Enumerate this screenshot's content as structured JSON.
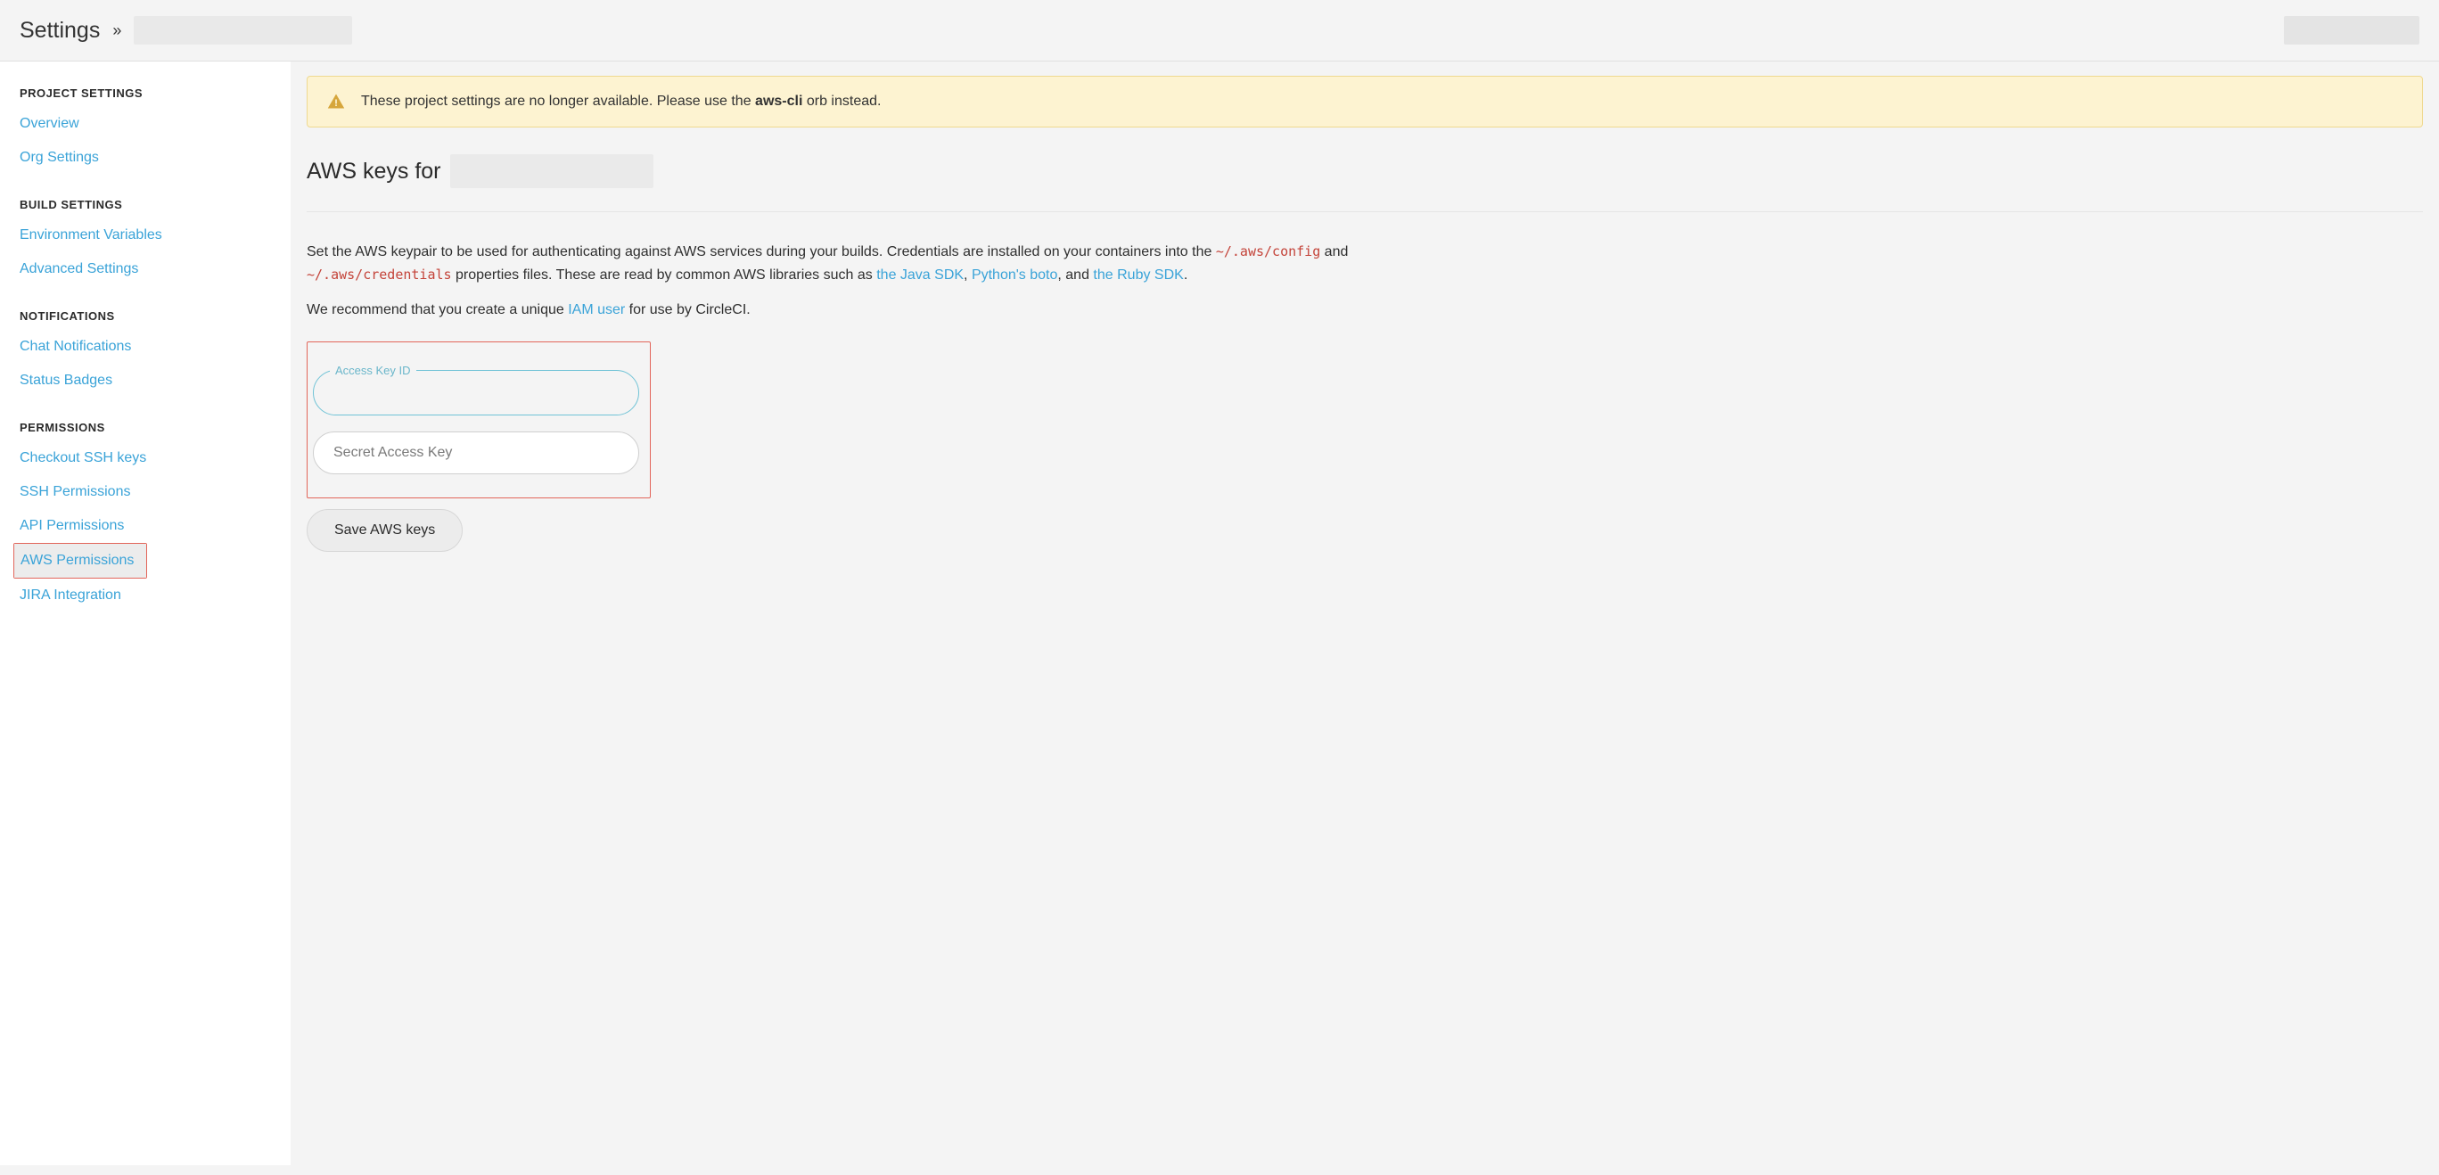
{
  "header": {
    "title": "Settings",
    "separator": "»"
  },
  "sidebar": {
    "sections": {
      "project_settings": {
        "title": "PROJECT SETTINGS",
        "items": [
          {
            "label": "Overview"
          },
          {
            "label": "Org Settings"
          }
        ]
      },
      "build_settings": {
        "title": "BUILD SETTINGS",
        "items": [
          {
            "label": "Environment Variables"
          },
          {
            "label": "Advanced Settings"
          }
        ]
      },
      "notifications": {
        "title": "NOTIFICATIONS",
        "items": [
          {
            "label": "Chat Notifications"
          },
          {
            "label": "Status Badges"
          }
        ]
      },
      "permissions": {
        "title": "PERMISSIONS",
        "items": [
          {
            "label": "Checkout SSH keys"
          },
          {
            "label": "SSH Permissions"
          },
          {
            "label": "API Permissions"
          },
          {
            "label": "AWS Permissions"
          },
          {
            "label": "JIRA Integration"
          }
        ]
      }
    }
  },
  "main": {
    "banner": {
      "text_before": "These project settings are no longer available. Please use the ",
      "bold": "aws-cli",
      "text_after": " orb instead."
    },
    "heading_prefix": "AWS keys for",
    "desc1_a": "Set the AWS keypair to be used for authenticating against AWS services during your builds. Credentials are installed on your containers into the ",
    "code1": "~/.aws/config",
    "desc1_b": " and ",
    "code2": "~/.aws/credentials",
    "desc1_c": " properties files. These are read by common AWS libraries such as ",
    "link_java": "the Java SDK",
    "comma1": ", ",
    "link_boto": "Python's boto",
    "comma2": ", and ",
    "link_ruby": "the Ruby SDK",
    "period": ".",
    "desc2_a": "We recommend that you create a unique ",
    "link_iam": "IAM user",
    "desc2_b": " for use by CircleCI.",
    "form": {
      "access_key_label": "Access Key ID",
      "secret_key_placeholder": "Secret Access Key",
      "save_button": "Save AWS keys"
    }
  }
}
